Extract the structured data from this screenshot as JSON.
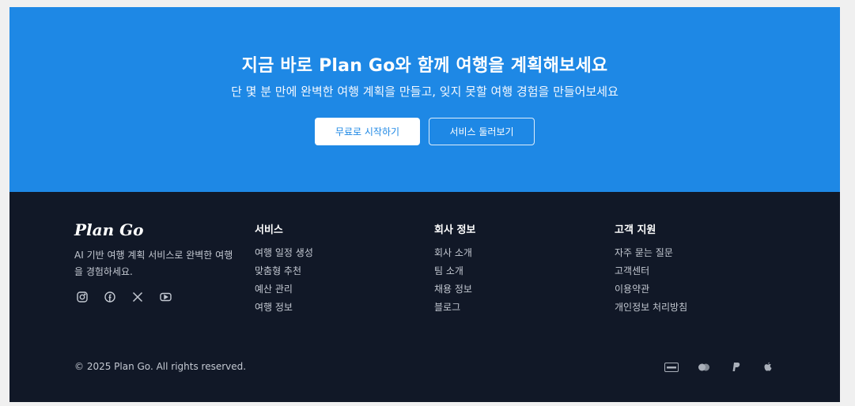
{
  "cta": {
    "title": "지금 바로 Plan Go와 함께 여행을 계획해보세요",
    "subtitle": "단 몇 분 만에 완벽한 여행 계획을 만들고, 잊지 못할 여행 경험을 만들어보세요",
    "primary_button": "무료로 시작하기",
    "secondary_button": "서비스 둘러보기",
    "colors": {
      "background": "#1e88e5",
      "text": "#ffffff"
    }
  },
  "footer": {
    "brand": {
      "logo": "Plan Go",
      "description": "AI 기반 여행 계획 서비스로 완벽한 여행을 경험하세요."
    },
    "socials": [
      "instagram-icon",
      "facebook-icon",
      "x-icon",
      "youtube-icon"
    ],
    "columns": [
      {
        "heading": "서비스",
        "items": [
          "여행 일정 생성",
          "맞춤형 추천",
          "예산 관리",
          "여행 정보"
        ]
      },
      {
        "heading": "회사 정보",
        "items": [
          "회사 소개",
          "팀 소개",
          "채용 정보",
          "블로그"
        ]
      },
      {
        "heading": "고객 지원",
        "items": [
          "자주 묻는 질문",
          "고객센터",
          "이용약관",
          "개인정보 처리방침"
        ]
      }
    ],
    "copyright": "© 2025 Plan Go. All rights reserved.",
    "payments": [
      "visa-icon",
      "mastercard-icon",
      "paypal-icon",
      "apple-icon"
    ],
    "colors": {
      "background": "#111827",
      "muted_text": "#c4c9d2"
    }
  }
}
